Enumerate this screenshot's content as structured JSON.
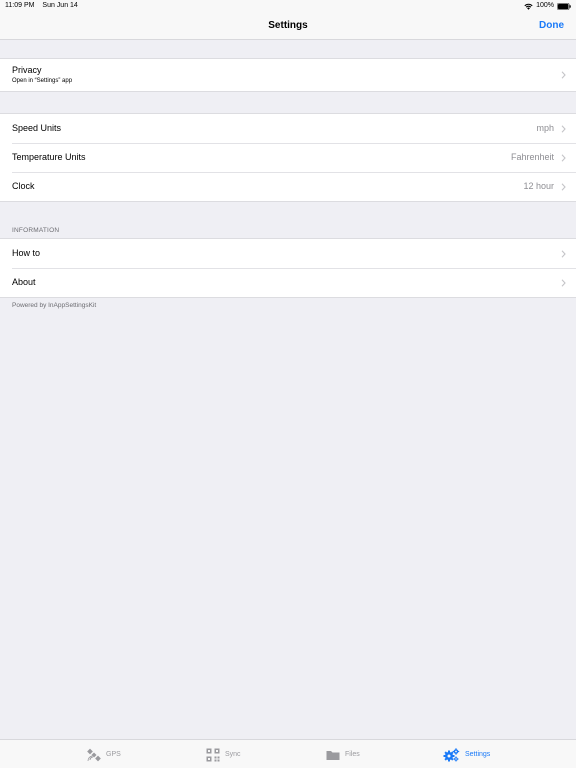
{
  "status": {
    "time": "11:09 PM",
    "date": "Sun Jun 14",
    "battery": "100%"
  },
  "nav": {
    "title": "Settings",
    "done_label": "Done"
  },
  "privacy": {
    "title": "Privacy",
    "subtitle": "Open in “Settings” app"
  },
  "units": [
    {
      "title": "Speed Units",
      "value": "mph"
    },
    {
      "title": "Temperature Units",
      "value": "Fahrenheit"
    },
    {
      "title": "Clock",
      "value": "12 hour"
    }
  ],
  "information": {
    "header": "INFORMATION",
    "items": [
      {
        "title": "How to"
      },
      {
        "title": "About"
      }
    ],
    "footer": "Powered by InAppSettingsKit"
  },
  "tabs": [
    {
      "label": "GPS",
      "icon": "satellite-icon"
    },
    {
      "label": "Sync",
      "icon": "qr-code-icon"
    },
    {
      "label": "Files",
      "icon": "folder-icon"
    },
    {
      "label": "Settings",
      "icon": "gears-icon"
    }
  ],
  "colors": {
    "accent": "#1a7af8",
    "background": "#efeff4",
    "secondary_text": "#8e8e93"
  }
}
